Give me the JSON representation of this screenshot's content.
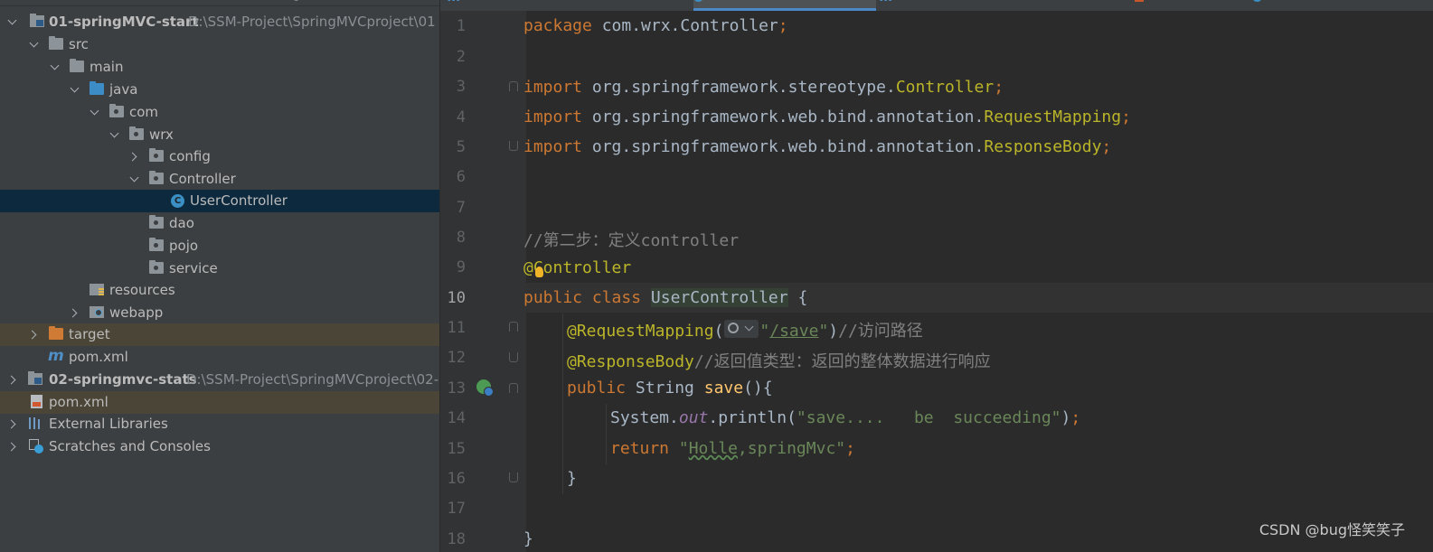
{
  "tree": {
    "items": [
      {
        "label": "01-springMVC-start",
        "path": "D:\\SSM-Project\\SpringMVCproject\\01"
      },
      {
        "label": "src"
      },
      {
        "label": "main"
      },
      {
        "label": "java"
      },
      {
        "label": "com"
      },
      {
        "label": "wrx"
      },
      {
        "label": "config"
      },
      {
        "label": "Controller"
      },
      {
        "label": "UserController"
      },
      {
        "label": "dao"
      },
      {
        "label": "pojo"
      },
      {
        "label": "service"
      },
      {
        "label": "resources"
      },
      {
        "label": "webapp"
      },
      {
        "label": "target"
      },
      {
        "label": "pom.xml"
      },
      {
        "label": "02-springmvc-stats",
        "path": "D:\\SSM-Project\\SpringMVCproject\\02-"
      },
      {
        "label": "pom.xml"
      },
      {
        "label": "External Libraries"
      },
      {
        "label": "Scratches and Consoles"
      }
    ]
  },
  "editor": {
    "line_numbers": [
      "1",
      "2",
      "3",
      "4",
      "5",
      "6",
      "7",
      "8",
      "9",
      "10",
      "11",
      "12",
      "13",
      "14",
      "15",
      "16",
      "17",
      "18"
    ],
    "current_line": "10",
    "code": {
      "l1_kw": "package",
      "l1_rest": " com.wrx.Controller",
      "l1_semi": ";",
      "l3_kw": "import",
      "l3_rest": " org.springframework.stereotype.",
      "l3_cls": "Controller",
      "l3_semi": ";",
      "l4_kw": "import",
      "l4_rest": " org.springframework.web.bind.annotation.",
      "l4_cls": "RequestMapping",
      "l4_semi": ";",
      "l5_kw": "import",
      "l5_rest": " org.springframework.web.bind.annotation.",
      "l5_cls": "ResponseBody",
      "l5_semi": ";",
      "l8_comment": "//第二步：定义controller",
      "l9_ann": "@Controller",
      "l10_kw": "public class",
      "l10_cls": "UserController",
      "l10_brace": " {",
      "l11_ann": "@RequestMapping",
      "l11_open": "(",
      "l11_q1": "\"",
      "l11_path": "/save",
      "l11_q2": "\"",
      "l11_close": ")",
      "l11_comment": "//访问路径",
      "l12_ann": "@ResponseBody",
      "l12_comment": "//返回值类型：返回的整体数据进行响应",
      "l13_kw": "public",
      "l13_type": " String ",
      "l13_fn": "save",
      "l13_rest": "(){",
      "l14_pre": "System.",
      "l14_field": "out",
      "l14_mid": ".println(",
      "l14_str": "\"save....   be  succeeding\"",
      "l14_end": ")",
      "l14_semi": ";",
      "l15_kw": "return",
      "l15_q": " \"",
      "l15_typo": "Holle",
      "l15_str": ",springMvc\"",
      "l15_semi": ";",
      "l16": "}",
      "l18": "}"
    }
  },
  "watermark": "CSDN @bug怪笑笑子"
}
